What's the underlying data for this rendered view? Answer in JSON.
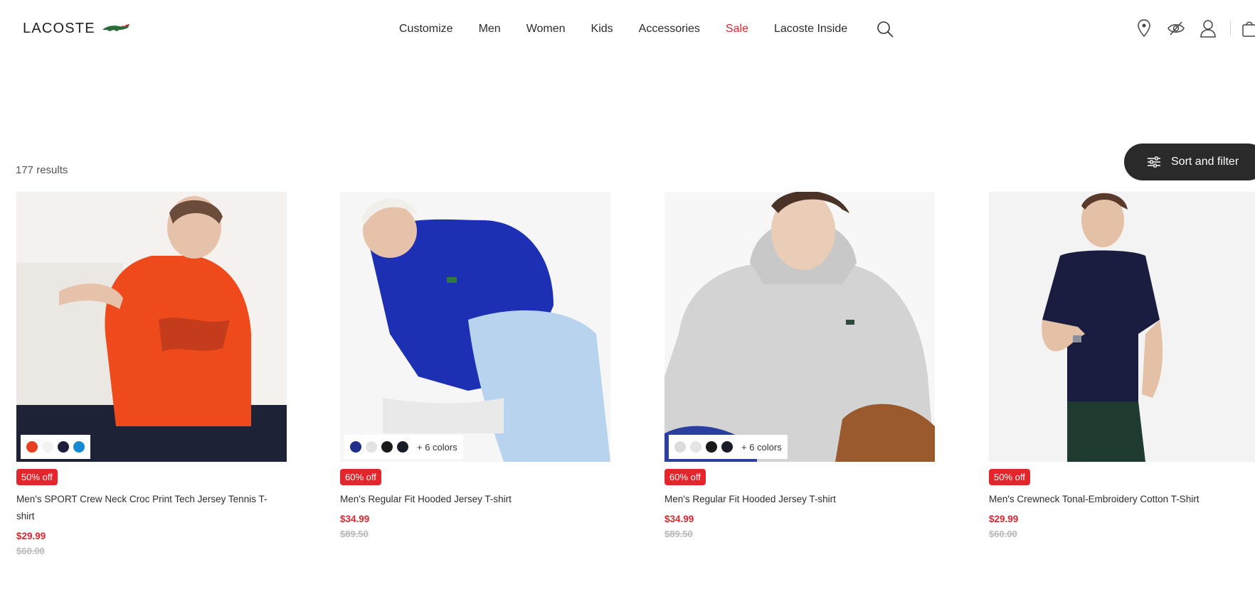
{
  "header": {
    "logo_text": "LACOSTE",
    "nav": [
      "Customize",
      "Men",
      "Women",
      "Kids",
      "Accessories",
      "Sale",
      "Lacoste Inside"
    ],
    "icons": [
      "search-icon",
      "store-locator-icon",
      "accessibility-icon",
      "account-icon",
      "cart-icon"
    ]
  },
  "listing": {
    "results_text": "177 results",
    "sort_filter_label": "Sort and filter"
  },
  "colors": {
    "accent_red": "#e3262b",
    "sale_red": "#d7282f",
    "button_dark": "#2a2a2a"
  },
  "products": [
    {
      "name": "Men's SPORT Crew Neck Croc Print Tech Jersey Tennis T-shirt",
      "badge": "50% off",
      "price": "$29.99",
      "original_price": "$60.00",
      "swatches": [
        "#e8401f",
        "#f2f2f2",
        "#1c1f3b",
        "#168ad0"
      ],
      "more_colors": ""
    },
    {
      "name": "Men's Regular Fit Hooded Jersey T-shirt",
      "badge": "60% off",
      "price": "$34.99",
      "original_price": "$89.50",
      "swatches": [
        "#1f2f8a",
        "#e3e3e3",
        "#1a1a1a",
        "#1b1c2a"
      ],
      "more_colors": "+ 6 colors"
    },
    {
      "name": "Men's Regular Fit Hooded Jersey T-shirt",
      "badge": "60% off",
      "price": "$34.99",
      "original_price": "$89.50",
      "swatches": [
        "#dcdcdc",
        "#e5e5e5",
        "#1a1a1a",
        "#1b1c2a"
      ],
      "more_colors": "+ 6 colors"
    },
    {
      "name": "Men's Crewneck Tonal-Embroidery Cotton T-Shirt",
      "badge": "50% off",
      "price": "$29.99",
      "original_price": "$60.00",
      "swatches": [],
      "more_colors": ""
    }
  ]
}
